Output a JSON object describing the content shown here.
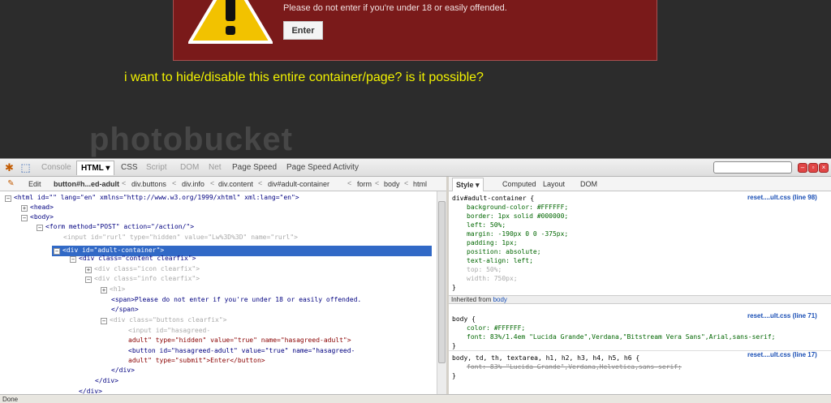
{
  "webpage": {
    "warning_text": "Please do not enter if you're under 18 or easily offended.",
    "enter_label": "Enter",
    "question": "i want to hide/disable this entire container/page? is it possible?"
  },
  "firebug": {
    "tabs": [
      "Console",
      "HTML",
      "CSS",
      "Script",
      "DOM",
      "Net",
      "Page Speed",
      "Page Speed Activity"
    ],
    "active_tab": "HTML",
    "breadcrumbs": [
      "Edit",
      "button#h...ed-adult",
      "div.buttons",
      "div.info",
      "div.content",
      "div#adult-container",
      "form",
      "body",
      "html"
    ],
    "side_tabs": [
      "Style",
      "Computed",
      "Layout",
      "DOM"
    ],
    "html_lines": [
      {
        "a": "<html id=\"\" lang=\"en\" xmlns=\"http://www.w3.org/1999/xhtml\" xml:lang=\"en\">"
      },
      {
        "a": "<head>"
      },
      {
        "a": "<body>"
      },
      {
        "a": "<form method=\"POST\" action=\"/action/\">"
      },
      {
        "a": "<input id=\"rurl\" type=\"hidden\" value=\"Lw%3D%3D\" name=\"rurl\">"
      },
      {
        "a": "<div id=\"adult-container\">"
      },
      {
        "a": "<div class=\"content clearfix\">"
      },
      {
        "a": "<div class=\"icon clearfix\">"
      },
      {
        "a": "<div class=\"info clearfix\">"
      },
      {
        "a": "<h1>"
      },
      {
        "a": "<span>Please do not enter if you're under 18 or easily offended."
      },
      {
        "a": "</span>"
      },
      {
        "a": "<div class=\"buttons clearfix\">"
      },
      {
        "a": "<input id=\"hasagreed-"
      },
      {
        "a": "adult\" type=\"hidden\" value=\"true\" name=\"hasagreed-adult\">"
      },
      {
        "a": "<button id=\"hasagreed-adult\" value=\"true\" name=\"hasagreed-"
      },
      {
        "a": "adult\" type=\"submit\">Enter</button>"
      },
      {
        "a": "</div>"
      },
      {
        "a": "</div>"
      },
      {
        "a": "</div>"
      }
    ],
    "rule1": {
      "selector": "div#adult-container {",
      "source": "reset....ult.css (line 98)",
      "props": [
        "background-color: #FFFFFF;",
        "border: 1px solid #000000;",
        "left: 50%;",
        "margin: -190px 0 0 -375px;",
        "padding: 1px;",
        "position: absolute;",
        "text-align: left;",
        "top: 50%;",
        "width: 750px;"
      ],
      "close": "}"
    },
    "inherited_label": "Inherited from ",
    "inherited_from": "body",
    "rule2": {
      "selector": "body {",
      "source": "reset....ult.css (line 71)",
      "props": [
        "color: #FFFFFF;",
        "font: 83%/1.4em \"Lucida Grande\",Verdana,\"Bitstream Vera Sans\",Arial,sans-serif;"
      ],
      "close": "}"
    },
    "rule3": {
      "selector": "body, td, th, textarea, h1, h2, h3, h4, h5, h6 {",
      "source": "reset....ult.css (line 17)",
      "props": [
        "font: 83% \"Lucida Grande\",Verdana,Helvetica,sans-serif;"
      ],
      "close": "}"
    },
    "status": "Done"
  },
  "watermark": "photobucket",
  "colors": {
    "accent": "#3169c6",
    "warning_bg": "#7a1a1a",
    "question": "#f2f200"
  }
}
